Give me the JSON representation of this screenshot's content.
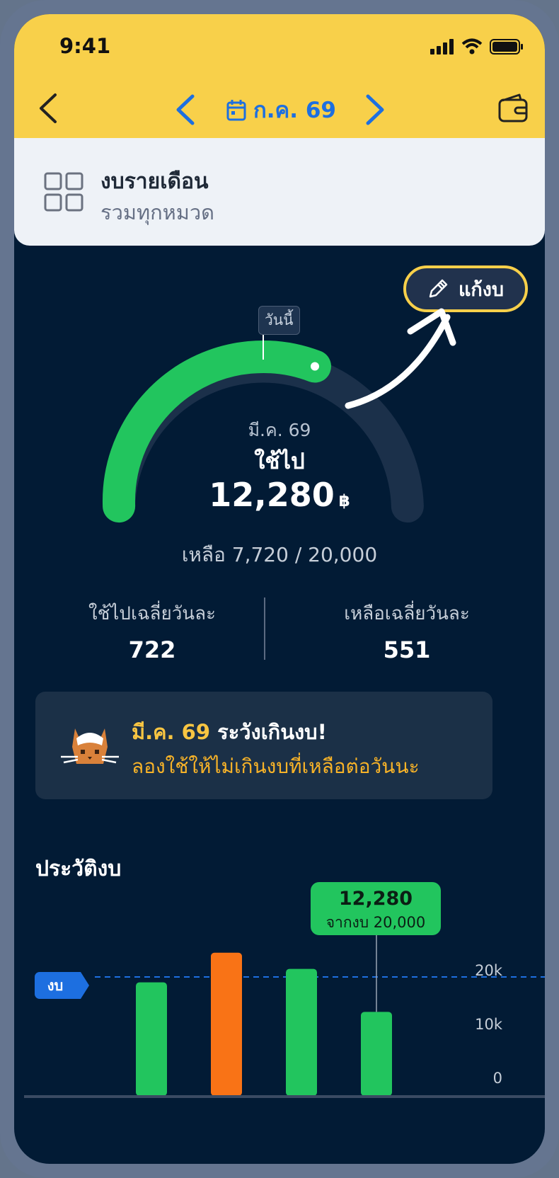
{
  "status": {
    "time": "9:41"
  },
  "nav": {
    "month_label": "ก.ค. 69"
  },
  "budget_card": {
    "title": "งบรายเดือน",
    "subtitle": "รวมทุกหมวด"
  },
  "edit_button": {
    "label": "แก้งบ"
  },
  "gauge": {
    "today_label": "วันนี้",
    "month": "มี.ค. 69",
    "used_label": "ใช้ไป",
    "used_amount": "12,280",
    "currency": "฿",
    "used_fraction": 0.614,
    "remaining_text": "เหลือ 7,720 / 20,000",
    "colors": {
      "used": "#22c55e",
      "track": "#1b304a"
    }
  },
  "averages": {
    "spent_label": "ใช้ไปเฉลี่ยวันละ",
    "spent_value": "722",
    "remain_label": "เหลือเฉลี่ยวันละ",
    "remain_value": "551"
  },
  "warning": {
    "month": "มี.ค. 69",
    "title": "ระวังเกินงบ!",
    "message": "ลองใช้ให้ไม่เกินงบที่เหลือต่อวันนะ"
  },
  "history": {
    "title": "ประวัติงบ",
    "budget_tag": "งบ",
    "tooltip_value": "12,280",
    "tooltip_sub": "จากงบ 20,000"
  },
  "chart_data": {
    "type": "bar",
    "ylim": [
      0,
      20000
    ],
    "ytick_labels": [
      "20k",
      "10k",
      "0"
    ],
    "budget_line": 20000,
    "values": [
      19000,
      24500,
      21500,
      13500
    ],
    "colors": [
      "#22c55e",
      "#f97316",
      "#22c55e",
      "#22c55e"
    ],
    "selected_index": 3
  }
}
